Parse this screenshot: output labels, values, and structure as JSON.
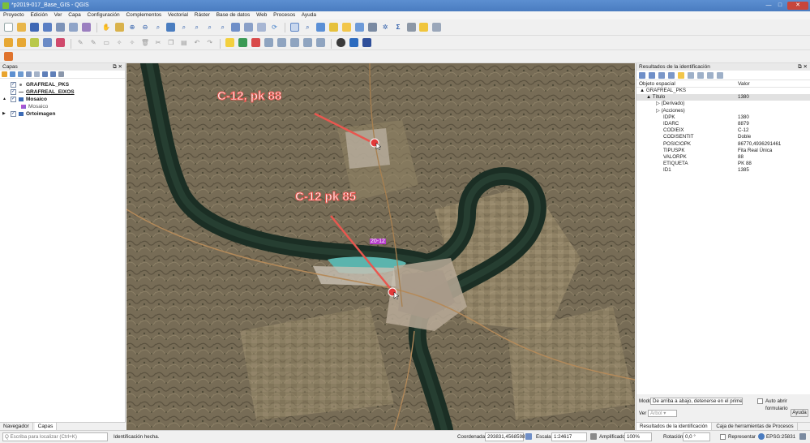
{
  "window": {
    "title": "*p2019-017_Base_GIS - QGIS",
    "min": "—",
    "max": "□",
    "close": "✕"
  },
  "menu": [
    "Proyecto",
    "Edición",
    "Ver",
    "Capa",
    "Configuración",
    "Complementos",
    "Vectorial",
    "Ráster",
    "Base de datos",
    "Web",
    "Procesos",
    "Ayuda"
  ],
  "layers_panel": {
    "title": "Capas",
    "controls": "⧉ ✕",
    "layers": [
      {
        "name": "GRAFREAL_PKS",
        "checked": "✓"
      },
      {
        "name": "GRAFREAL_EIXOS",
        "checked": "✓"
      },
      {
        "name": "Mosaico",
        "checked": "✓",
        "expander": "▲"
      },
      {
        "name": "Mosaico"
      },
      {
        "name": "Ortoimagen",
        "checked": "✓",
        "expander": "▶"
      }
    ],
    "tabs": [
      "Navegador",
      "Capas"
    ]
  },
  "map": {
    "labels": [
      "C-12, pk 88",
      "C-12 pk 85",
      "20-12"
    ],
    "colors": {
      "annotation": "#e8574f",
      "marker": "#e23a3a",
      "label_halo": "#b43cc8",
      "river": "#1b2e24"
    }
  },
  "identify_panel": {
    "title": "Resultados de la identificación",
    "controls": "⧉ ✕",
    "col_feature": "Objeto espacial",
    "col_value": "Valor",
    "rows": [
      {
        "key": "▲ GRAFREAL_PKS",
        "value": "",
        "indent": 0
      },
      {
        "key": "▲ Título",
        "value": "1380",
        "indent": 1,
        "selected": true
      },
      {
        "key": "▷ (Derivado)",
        "value": "",
        "indent": 2
      },
      {
        "key": "▷ (Acciones)",
        "value": "",
        "indent": 2
      },
      {
        "key": "IDPK",
        "value": "1380",
        "indent": 3
      },
      {
        "key": "IDARC",
        "value": "8879",
        "indent": 3
      },
      {
        "key": "CODIEIX",
        "value": "C-12",
        "indent": 3
      },
      {
        "key": "CODISENTIT",
        "value": "Doble",
        "indent": 3
      },
      {
        "key": "POSICIOPK",
        "value": "86770,4936291461",
        "indent": 3
      },
      {
        "key": "TIPUSPK",
        "value": "Fita Real Única",
        "indent": 3
      },
      {
        "key": "VALORPK",
        "value": "88",
        "indent": 3
      },
      {
        "key": "ETIQUETA",
        "value": "PK 88",
        "indent": 3
      },
      {
        "key": "ID1",
        "value": "1385",
        "indent": 3
      }
    ],
    "mode_label": "Modo",
    "mode_value": "De arriba a abajo, detenerse en el prime ▾",
    "auto_open_label": "Auto abrir formulario",
    "view_label": "Ver",
    "view_value": "Árbol",
    "view_arrow": "▾",
    "help_button": "Ayuda",
    "tabs": [
      "Resultados de la identificación",
      "Caja de herramientas de Procesos"
    ]
  },
  "status": {
    "search_placeholder": "Q  Escriba para localizar (Ctrl+K)",
    "message": "Identificación hecha.",
    "coord_label": "Coordenada",
    "coord_value": "293831,4568598",
    "scale_label": "Escala",
    "scale_value": "1:24617",
    "magnifier_label": "Amplificador",
    "magnifier_value": "100%",
    "rotation_label": "Rotación",
    "rotation_value": "0,0 °",
    "render_label": "Representar",
    "crs": "EPSG:25831"
  }
}
